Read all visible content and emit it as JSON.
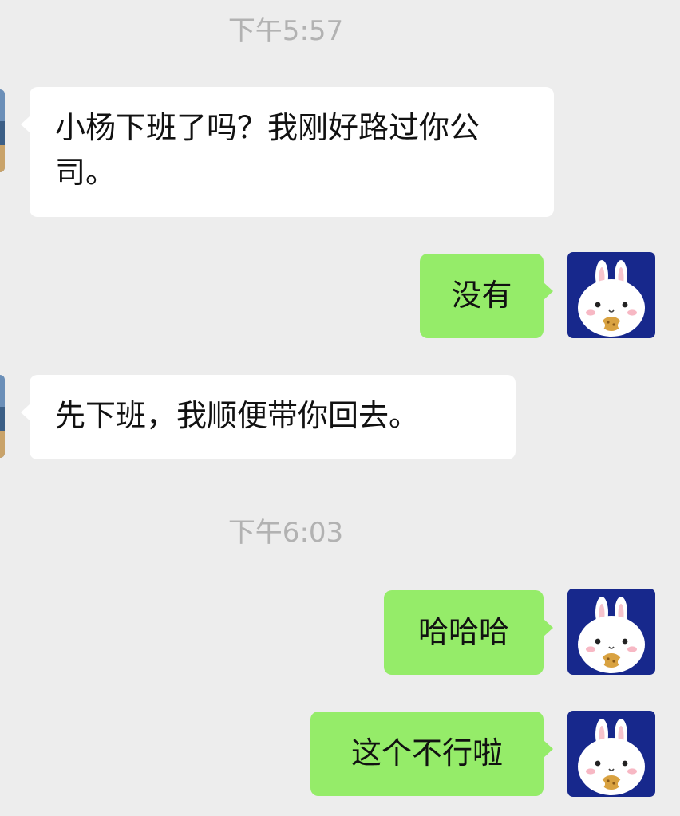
{
  "chat": {
    "timestamp_1": "下午5:57",
    "timestamp_2": "下午6:03",
    "messages": [
      {
        "sender": "other",
        "text": "小杨下班了吗？我刚好路过你公司。"
      },
      {
        "sender": "me",
        "text": "没有"
      },
      {
        "sender": "other",
        "text": "先下班，我顺便带你回去。"
      },
      {
        "sender": "me",
        "text": "哈哈哈"
      },
      {
        "sender": "me",
        "text": "这个不行啦"
      }
    ]
  },
  "colors": {
    "background": "#ededed",
    "incoming_bubble": "#ffffff",
    "outgoing_bubble": "#95ec69",
    "timestamp_text": "#b2b2b2",
    "avatar_background": "#17288c"
  },
  "avatars": {
    "self_icon": "white-rabbit-eating-cookie",
    "peer_icon": "landscape-photo"
  }
}
